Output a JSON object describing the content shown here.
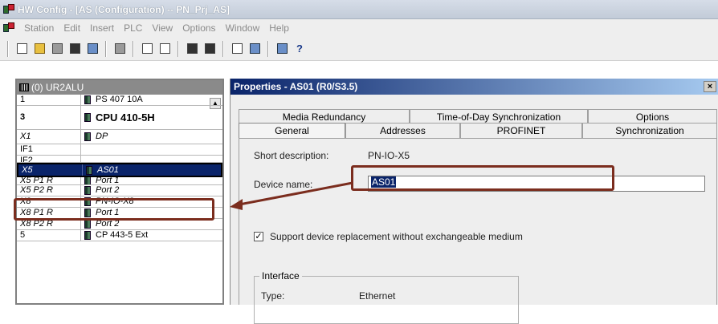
{
  "window": {
    "title": "HW Config - [AS (Configuration) -- PN_Prj_AS]"
  },
  "menu": [
    "Station",
    "Edit",
    "Insert",
    "PLC",
    "View",
    "Options",
    "Window",
    "Help"
  ],
  "toolbar": {
    "help_symbol": "?"
  },
  "rack": {
    "header": "(0) UR2ALU",
    "rows": [
      {
        "slot": "1",
        "module": "PS 407 10A"
      },
      {
        "slot": "3",
        "module": "CPU 410-5H"
      },
      {
        "slot": "X1",
        "module": "DP"
      },
      {
        "slot": "IF1",
        "module": ""
      },
      {
        "slot": "IF2",
        "module": ""
      },
      {
        "slot": "X5",
        "module": "AS01"
      },
      {
        "slot": "X5 P1 R",
        "module": "Port 1"
      },
      {
        "slot": "X5 P2 R",
        "module": "Port 2"
      },
      {
        "slot": "X8",
        "module": "PN-IO-X8"
      },
      {
        "slot": "X8 P1 R",
        "module": "Port 1"
      },
      {
        "slot": "X8 P2 R",
        "module": "Port 2"
      },
      {
        "slot": "5",
        "module": "CP 443-5 Ext"
      }
    ]
  },
  "dialog": {
    "title": "Properties - AS01 (R0/S3.5)",
    "close": "×",
    "tabs_back": [
      "Media Redundancy",
      "Time-of-Day Synchronization",
      "Options"
    ],
    "tabs_front": [
      "General",
      "Addresses",
      "PROFINET",
      "Synchronization"
    ],
    "short_description_label": "Short description:",
    "short_description_value": "PN-IO-X5",
    "device_name_label": "Device name:",
    "device_name_value": "AS01",
    "checkbox_label": "Support device replacement without exchangeable medium",
    "checkbox_checked": "✓",
    "interface_legend": "Interface",
    "type_label": "Type:",
    "type_value": "Ethernet"
  },
  "colors": {
    "highlight": "#7b2d1e",
    "selection": "#0a246a"
  }
}
